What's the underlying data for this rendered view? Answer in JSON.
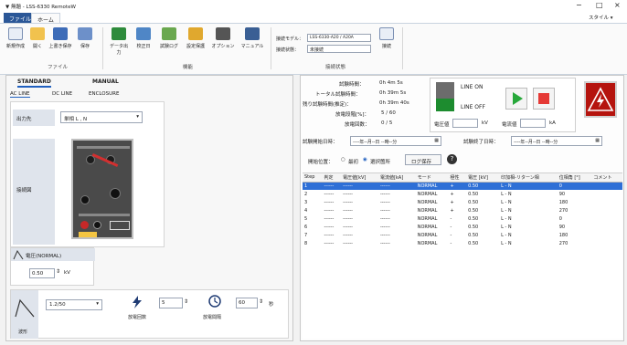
{
  "titlebar": {
    "title": "▼ 無題 - LSS-6330 RemoteW",
    "style_label": "スタイル ▾"
  },
  "tabs": [
    "ファイル",
    "ホーム"
  ],
  "ribbon": {
    "file_buttons": [
      "新規作成",
      "開く",
      "上書き保存",
      "保存"
    ],
    "func_buttons": [
      "データ出力",
      "校正日",
      "試験ログ",
      "設定保護",
      "オプション",
      "マニュアル"
    ],
    "group_file": "ファイル",
    "group_func": "機能",
    "group_conn": "接続状態",
    "model_label": "接続モデル：",
    "model_value": "LSS-6330-A20 / A20A",
    "state_label": "接続状態：",
    "state_value": "未接続",
    "connect_label": "接続"
  },
  "left": {
    "mode_tabs": [
      "STANDARD",
      "MANUAL"
    ],
    "sub_tabs": [
      "AC LINE",
      "DC LINE",
      "ENCLOSURE"
    ],
    "output_label": "出力先",
    "output_value": "単相 L , N",
    "diagram_label": "接続図",
    "voltage_title": "電圧(NORMAL)",
    "voltage_value": "0.50",
    "voltage_unit": "kV",
    "waveform_value": "1.2/50",
    "waveform_label": "波形",
    "count_label": "放電回数",
    "count_value": "5",
    "interval_label": "放電間隔",
    "interval_value": "60",
    "interval_unit": "秒"
  },
  "status": {
    "test_time_label": "試験時間：",
    "test_time_value": "0h  4m  5s",
    "total_time_label": "トータル試験時間：",
    "total_time_value": "0h 39m  5s",
    "remaining_label": "残り試験時間(推定)：",
    "remaining_value": "0h 39m 40s",
    "step_label": "放電段階[%]：",
    "step_value": "5 / 60",
    "discharge_label": "放電回数：",
    "discharge_value": "0 / 5",
    "line_on": "LINE ON",
    "line_off": "LINE OFF",
    "voltage_label": "電圧値",
    "voltage_unit": "kV",
    "current_label": "電流値",
    "current_unit": "kA",
    "start_label": "試験開始日時：",
    "start_value": "----年--月--日 --時--分",
    "end_label": "試験終了日時：",
    "end_value": "----年--月--日 --時--分"
  },
  "controls": {
    "start_pos_label": "開始位置：",
    "radio_first": "最初",
    "radio_selected": "選択箇所",
    "log_button": "ログ保存"
  },
  "table": {
    "headers": [
      "Step",
      "判定",
      "電圧値[kV]",
      "電流値[kA]",
      "モード",
      "極性",
      "電圧 [kV]",
      "印加相-リターン相",
      "位相角 [°]",
      "コメント"
    ],
    "rows": [
      [
        "1",
        "------",
        "------",
        "------",
        "NORMAL",
        "+",
        "0.50",
        "L - N",
        "0",
        ""
      ],
      [
        "2",
        "------",
        "------",
        "------",
        "NORMAL",
        "+",
        "0.50",
        "L - N",
        "90",
        ""
      ],
      [
        "3",
        "------",
        "------",
        "------",
        "NORMAL",
        "+",
        "0.50",
        "L - N",
        "180",
        ""
      ],
      [
        "4",
        "------",
        "------",
        "------",
        "NORMAL",
        "+",
        "0.50",
        "L - N",
        "270",
        ""
      ],
      [
        "5",
        "------",
        "------",
        "------",
        "NORMAL",
        "-",
        "0.50",
        "L - N",
        "0",
        ""
      ],
      [
        "6",
        "------",
        "------",
        "------",
        "NORMAL",
        "-",
        "0.50",
        "L - N",
        "90",
        ""
      ],
      [
        "7",
        "------",
        "------",
        "------",
        "NORMAL",
        "-",
        "0.50",
        "L - N",
        "180",
        ""
      ],
      [
        "8",
        "------",
        "------",
        "------",
        "NORMAL",
        "-",
        "0.50",
        "L - N",
        "270",
        ""
      ]
    ]
  },
  "colors": {
    "accent": "#1f5fbf",
    "selected_row": "#2e6fd6",
    "stop_red": "#e53935",
    "play_green": "#27a83a",
    "warn_bg": "#b5140e"
  }
}
